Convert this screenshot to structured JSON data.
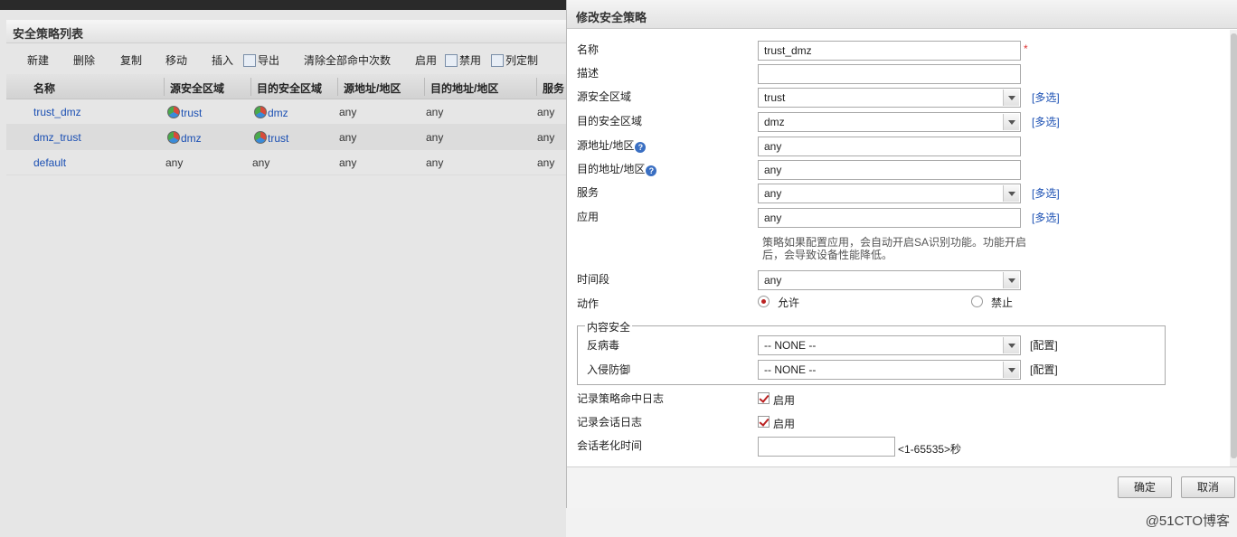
{
  "left_panel": {
    "title": "安全策略列表",
    "toolbar": {
      "new": "新建",
      "delete": "删除",
      "copy": "复制",
      "move": "移动",
      "insert": "插入",
      "export": "导出",
      "clear_hits": "清除全部命中次数",
      "enable": "启用",
      "disable": "禁用",
      "columns": "列定制"
    },
    "table": {
      "headers": [
        "名称",
        "源安全区域",
        "目的安全区域",
        "源地址/地区",
        "目的地址/地区",
        "服务"
      ],
      "rows": [
        {
          "name": "trust_dmz",
          "src_zone": "trust",
          "dst_zone": "dmz",
          "src_addr": "any",
          "dst_addr": "any",
          "service": "any"
        },
        {
          "name": "dmz_trust",
          "src_zone": "dmz",
          "dst_zone": "trust",
          "src_addr": "any",
          "dst_addr": "any",
          "service": "any"
        },
        {
          "name": "default",
          "src_zone": "any",
          "dst_zone": "any",
          "src_addr": "any",
          "dst_addr": "any",
          "service": "any"
        }
      ]
    }
  },
  "dialog": {
    "title": "修改安全策略",
    "labels": {
      "name": "名称",
      "desc": "描述",
      "src_zone": "源安全区域",
      "dst_zone": "目的安全区域",
      "src_addr": "源地址/地区",
      "dst_addr": "目的地址/地区",
      "service": "服务",
      "app": "应用",
      "time": "时间段",
      "action": "动作",
      "content_security": "内容安全",
      "antivirus": "反病毒",
      "ips": "入侵防御",
      "log_hit": "记录策略命中日志",
      "log_session": "记录会话日志",
      "session_timeout": "会话老化时间"
    },
    "values": {
      "name": "trust_dmz",
      "desc": "",
      "src_zone": "trust",
      "dst_zone": "dmz",
      "src_addr": "any",
      "dst_addr": "any",
      "service": "any",
      "app": "any",
      "time": "any",
      "antivirus": "-- NONE --",
      "ips": "-- NONE --",
      "session_timeout": ""
    },
    "required_mark": "*",
    "multi_select": "[多选]",
    "config": "[配置]",
    "help_icon": "?",
    "app_note": "策略如果配置应用，会自动开启SA识别功能。功能开启后，会导致设备性能降低。",
    "action_allow": "允许",
    "action_deny": "禁止",
    "action_selected": "allow",
    "enable_label": "启用",
    "log_hit_checked": true,
    "log_session_checked": true,
    "timeout_hint": "<1-65535>秒",
    "ok": "确定",
    "cancel": "取消"
  },
  "watermark": "@51CTO博客"
}
